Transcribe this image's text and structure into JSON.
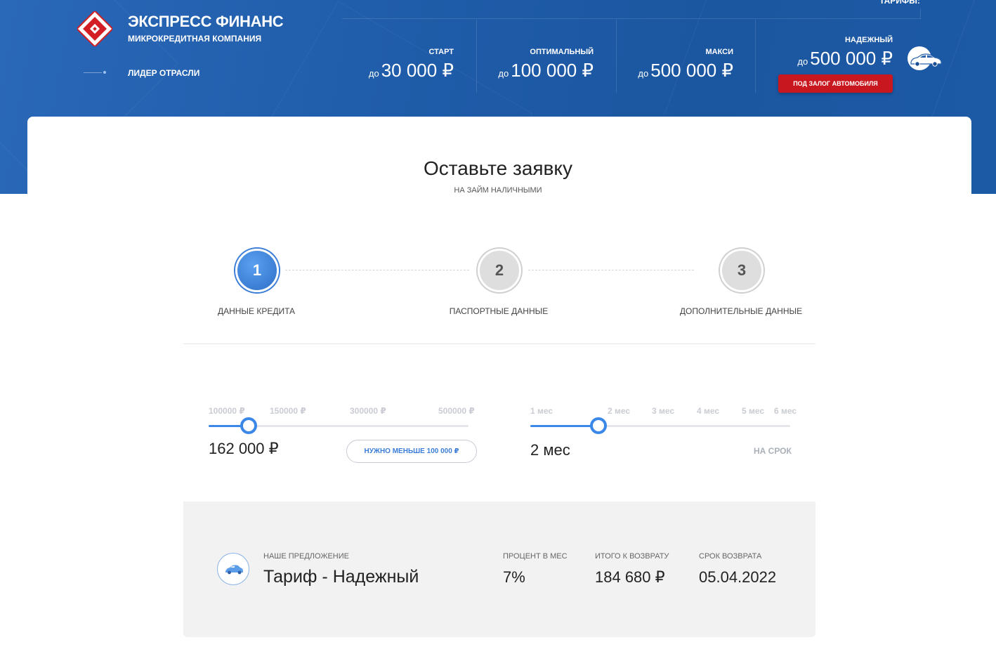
{
  "brand": {
    "title": "ЭКСПРЕСС ФИНАНС",
    "subtitle": "МИКРОКРЕДИТНАЯ КОМПАНИЯ",
    "leader": "ЛИДЕР ОТРАСЛИ"
  },
  "tariffs": {
    "title": "ТАРИФЫ:",
    "items": [
      {
        "name": "СТАРТ",
        "prefix": "до",
        "amount": "30 000 ₽"
      },
      {
        "name": "ОПТИМАЛЬНЫЙ",
        "prefix": "до",
        "amount": "100 000 ₽"
      },
      {
        "name": "МАКСИ",
        "prefix": "до",
        "amount": "500 000 ₽"
      },
      {
        "name": "НАДЕЖНЫЙ",
        "prefix": "до",
        "amount": "500 000 ₽"
      }
    ],
    "collateral_button": "ПОД ЗАЛОГ АВТОМОБИЛЯ"
  },
  "form": {
    "title": "Оставьте заявку",
    "subtitle": "НА ЗАЙМ НАЛИЧНЫМИ"
  },
  "steps": [
    {
      "number": "1",
      "label": "ДАННЫЕ КРЕДИТА",
      "active": true
    },
    {
      "number": "2",
      "label": "ПАСПОРТНЫЕ ДАННЫЕ",
      "active": false
    },
    {
      "number": "3",
      "label": "ДОПОЛНИТЕЛЬНЫЕ ДАННЫЕ",
      "active": false
    }
  ],
  "amount_slider": {
    "ticks": [
      "100000 ₽",
      "150000 ₽",
      "300000 ₽",
      "500000 ₽"
    ],
    "value": "162 000 ₽",
    "less_button": "НУЖНО МЕНЬШЕ 100 000 ₽"
  },
  "term_slider": {
    "ticks": [
      "1 мес",
      "2 мес",
      "3 мес",
      "4 мес",
      "5 мес",
      "6 мес"
    ],
    "value": "2 мес",
    "label": "НА СРОК"
  },
  "offer": {
    "caption": "НАШЕ ПРЕДЛОЖЕНИЕ",
    "name": "Тариф - Надежный",
    "rate_caption": "ПРОЦЕНТ В МЕС",
    "rate": "7%",
    "total_caption": "ИТОГО К ВОЗВРАТУ",
    "total": "184 680 ₽",
    "due_caption": "СРОК ВОЗВРАТА",
    "due": "05.04.2022"
  },
  "colors": {
    "header_blue": "#1f5ca9",
    "accent_blue": "#3b88e8",
    "red": "#c8171e"
  }
}
